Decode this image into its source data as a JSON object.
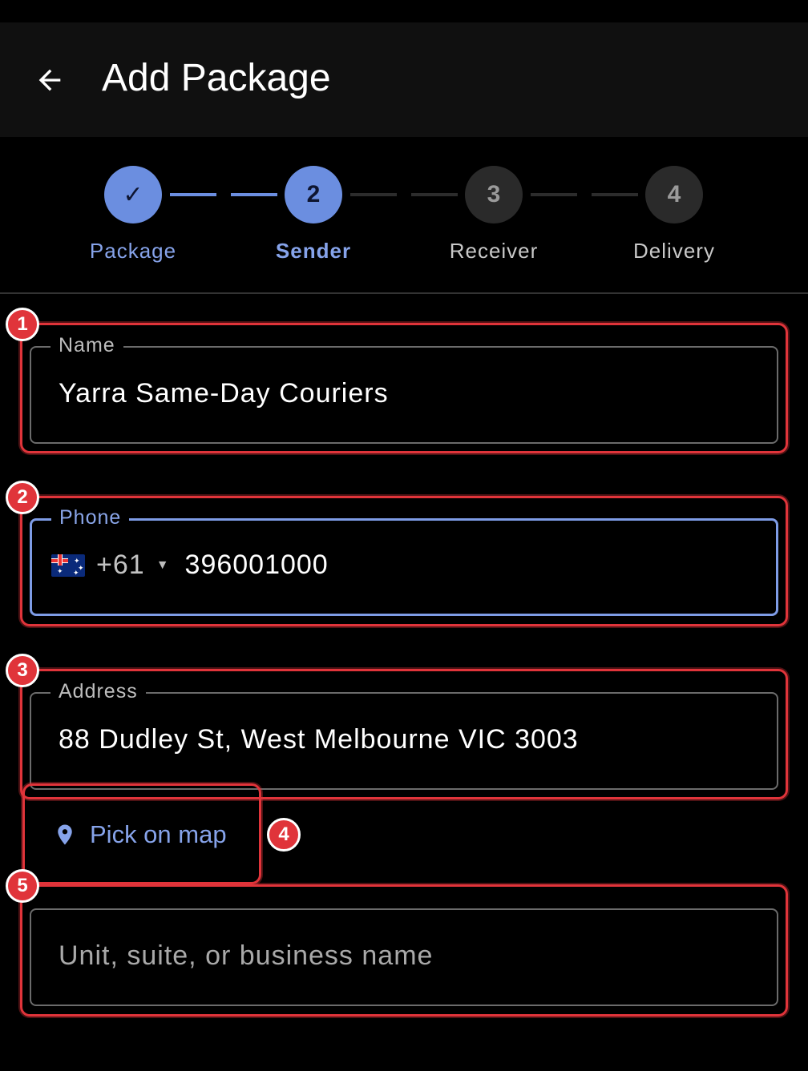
{
  "app_bar": {
    "title": "Add Package",
    "back_icon": "arrow-left-icon"
  },
  "stepper": {
    "steps": [
      {
        "label": "Package",
        "indicator": "✓",
        "state": "done"
      },
      {
        "label": "Sender",
        "indicator": "2",
        "state": "current"
      },
      {
        "label": "Receiver",
        "indicator": "3",
        "state": "pending"
      },
      {
        "label": "Delivery",
        "indicator": "4",
        "state": "pending"
      }
    ]
  },
  "form": {
    "name": {
      "label": "Name",
      "value": "Yarra Same-Day Couriers"
    },
    "phone": {
      "label": "Phone",
      "country_flag": "australia-flag",
      "dial_code": "+61",
      "dropdown_icon": "▼",
      "value": "396001000"
    },
    "address": {
      "label": "Address",
      "value": "88 Dudley St, West Melbourne VIC 3003"
    },
    "pick_on_map": {
      "label": "Pick on map",
      "icon": "map-pin-icon"
    },
    "unit": {
      "placeholder": "Unit, suite, or business name",
      "value": ""
    }
  },
  "annotations": [
    "1",
    "2",
    "3",
    "4",
    "5"
  ],
  "colors": {
    "accent": "#6b8ee0",
    "highlight": "#e0343a",
    "background": "#000000",
    "app_bar": "#101010"
  }
}
